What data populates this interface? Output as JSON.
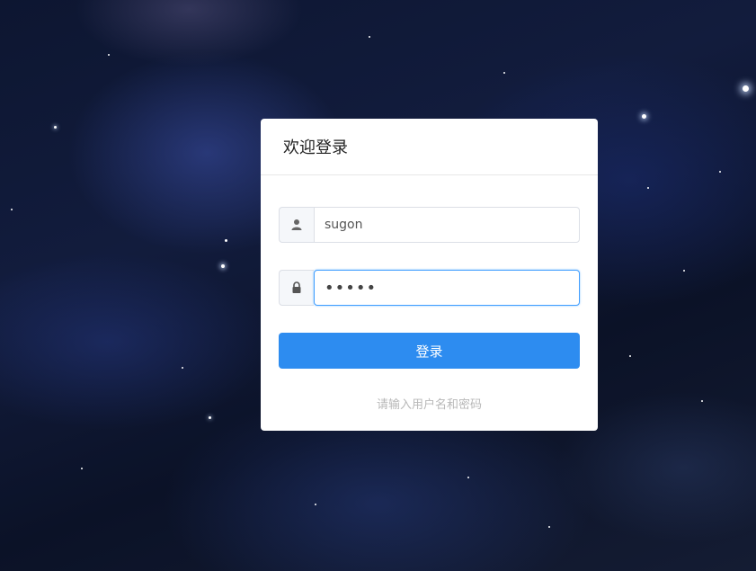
{
  "login": {
    "title": "欢迎登录",
    "username_value": "sugon",
    "password_value": "•••••",
    "submit_label": "登录",
    "hint": "请输入用户名和密码"
  },
  "icons": {
    "username": "user-icon",
    "password": "lock-icon"
  },
  "colors": {
    "primary": "#2d8cf0",
    "focus_border": "#409eff",
    "background": "#0d1631"
  }
}
